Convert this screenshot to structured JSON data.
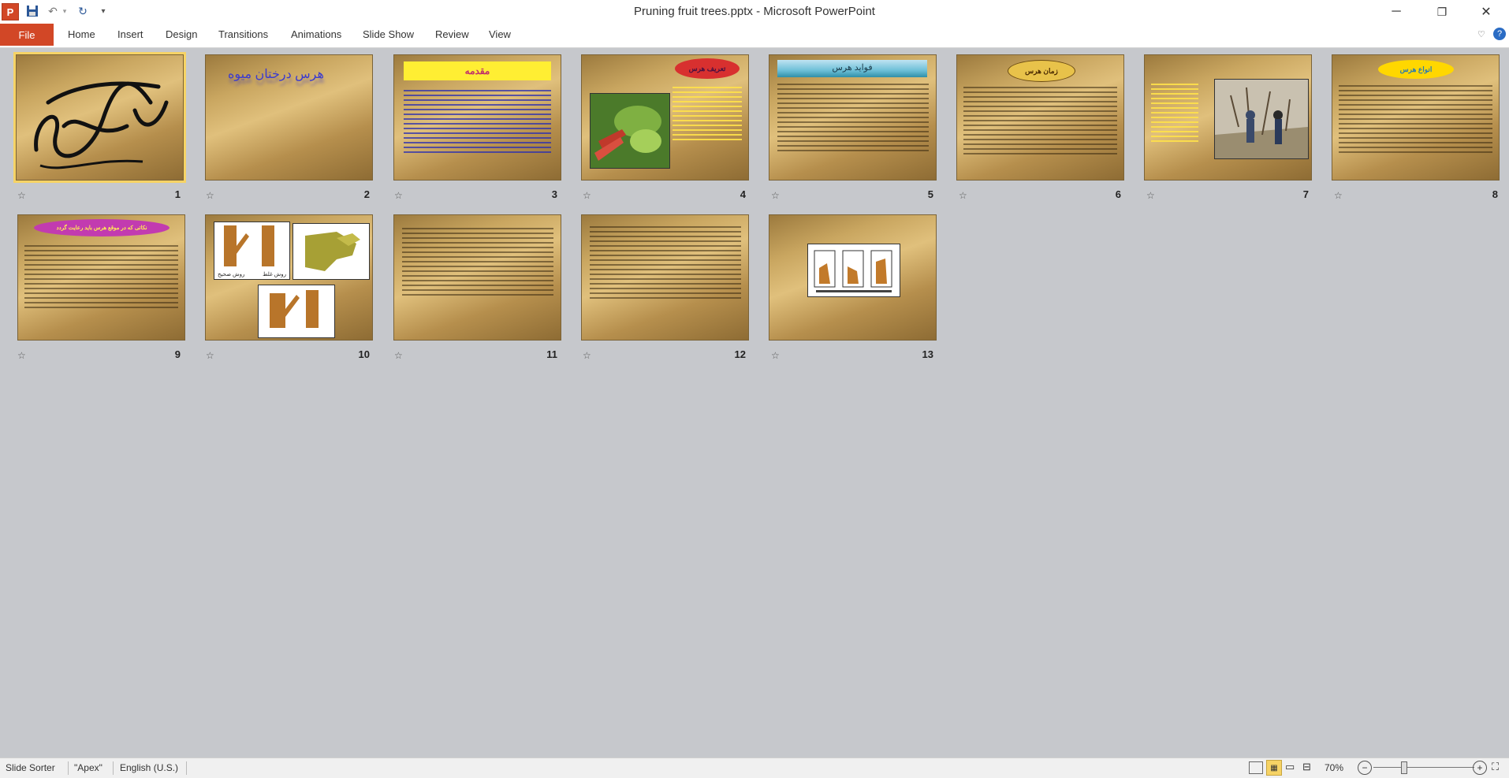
{
  "window": {
    "title": "Pruning fruit trees.pptx - Microsoft PowerPoint",
    "minimize_glyph": "─",
    "restore_glyph": "❐",
    "close_glyph": "✕"
  },
  "qat": {
    "app_icon": "P",
    "save_icon": "save-icon",
    "undo_icon": "undo-icon",
    "redo_icon": "redo-icon",
    "customize_icon": "chevron-down-icon"
  },
  "ribbon": {
    "file": "File",
    "tabs": [
      "Home",
      "Insert",
      "Design",
      "Transitions",
      "Animations",
      "Slide Show",
      "Review",
      "View"
    ]
  },
  "slides": [
    {
      "number": "1",
      "title": ""
    },
    {
      "number": "2",
      "title": "هرس درختان میوه"
    },
    {
      "number": "3",
      "title": "مقدمه"
    },
    {
      "number": "4",
      "title": "تعریف هرس"
    },
    {
      "number": "5",
      "title": "فواید هرس"
    },
    {
      "number": "6",
      "title": "زمان هرس"
    },
    {
      "number": "7",
      "title": ""
    },
    {
      "number": "8",
      "title": "انواع هرس"
    },
    {
      "number": "9",
      "title": "نکاتی که در موقع هرس باید رعایت گردد"
    },
    {
      "number": "10",
      "title": "",
      "captions": [
        "روش غلط",
        "روش صحیح"
      ]
    },
    {
      "number": "11",
      "title": ""
    },
    {
      "number": "12",
      "title": ""
    },
    {
      "number": "13",
      "title": ""
    }
  ],
  "statusbar": {
    "view": "Slide Sorter",
    "theme": "\"Apex\"",
    "language": "English (U.S.)",
    "zoom": "70%"
  },
  "colors": {
    "file_tab": "#d24726",
    "selection": "#f6d365",
    "background": "#c6c8cc"
  }
}
